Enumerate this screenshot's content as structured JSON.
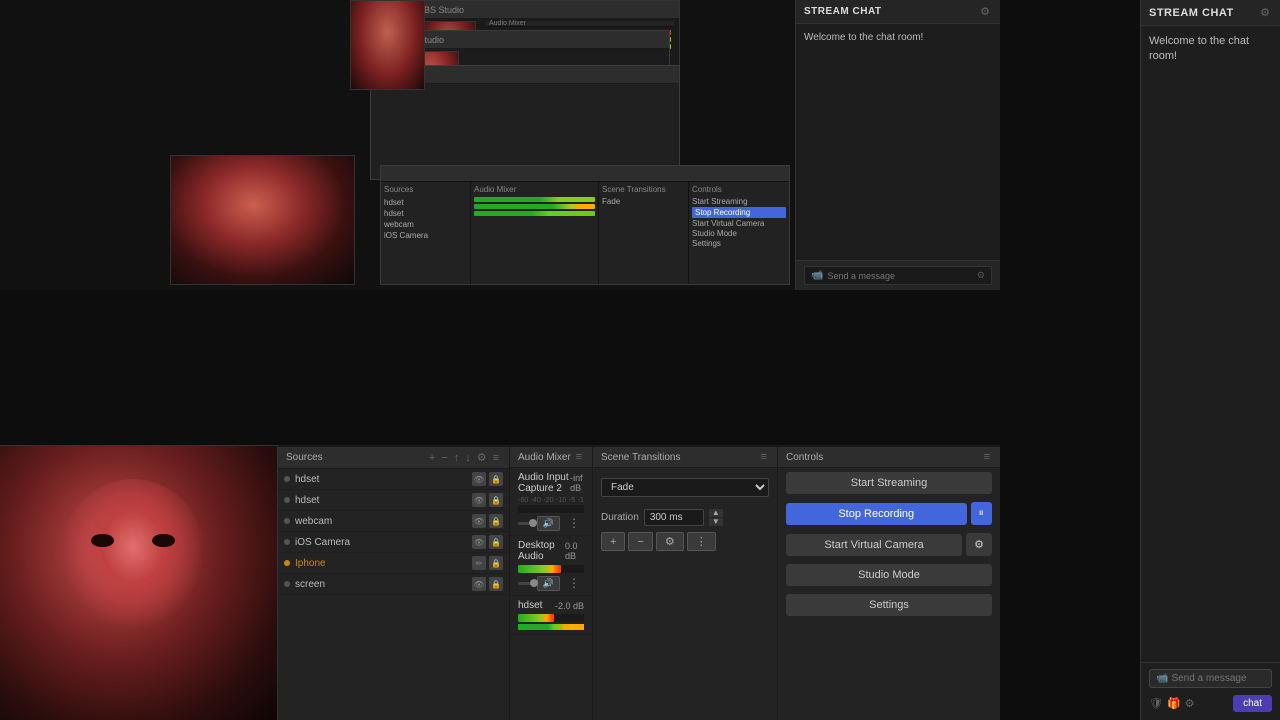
{
  "app": {
    "title": "OBS Studio"
  },
  "stream_chat": {
    "title": "STREAM CHAT",
    "welcome_message": "Welcome to the chat room!",
    "send_placeholder": "Send a message",
    "chat_label": "chat",
    "chat_button": "Chat"
  },
  "controls": {
    "title": "Controls",
    "start_streaming": "Start Streaming",
    "stop_recording": "Stop Recording",
    "start_virtual_camera": "Start Virtual Camera",
    "studio_mode": "Studio Mode",
    "settings": "Settings"
  },
  "audio_mixer": {
    "title": "Audio Mixer",
    "track1": {
      "name": "Audio Input Capture 2",
      "db": "-inf dB",
      "meter_pct": 0
    },
    "track2": {
      "name": "Desktop Audio",
      "db": "0.0 dB",
      "meter_pct": 65
    },
    "track3": {
      "name": "hdset",
      "db": "-2.0 dB",
      "meter_pct": 55
    }
  },
  "scene_transitions": {
    "title": "Scene Transitions",
    "fade_label": "Fade",
    "duration_label": "Duration",
    "duration_value": "300 ms"
  },
  "sources": {
    "title": "Sources",
    "items": [
      {
        "name": "hdset",
        "type": "audio"
      },
      {
        "name": "hdset",
        "type": "audio"
      },
      {
        "name": "webcam",
        "type": "video"
      },
      {
        "name": "iOS Camera",
        "type": "video"
      },
      {
        "name": "Iphone",
        "type": "video",
        "highlight": true
      },
      {
        "name": "screen",
        "type": "screen"
      }
    ]
  },
  "meter_scale": [
    "-60",
    "-40",
    "-20",
    "-10",
    "-5",
    "-1"
  ],
  "icons": {
    "close": "✕",
    "gear": "⚙",
    "pause": "⏸",
    "add": "+",
    "remove": "-",
    "eye": "👁",
    "lock": "🔒",
    "dots": "⋮",
    "chat_icon": "💬",
    "camera": "📷",
    "send": "➤",
    "smile": "😊"
  }
}
